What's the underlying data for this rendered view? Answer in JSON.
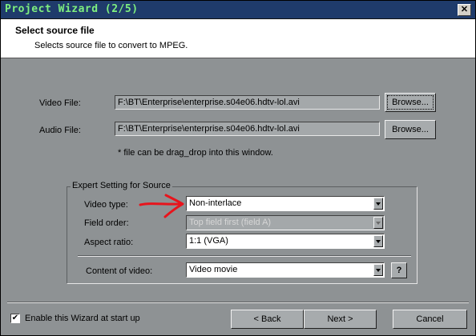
{
  "window": {
    "title": "Project Wizard (2/5)",
    "close_glyph": "✕"
  },
  "header": {
    "title": "Select source file",
    "subtitle": "Selects source file to convert to MPEG."
  },
  "source": {
    "video_label": "Video File:",
    "video_path": "F:\\BT\\Enterprise\\enterprise.s04e06.hdtv-lol.avi",
    "video_browse": "Browse...",
    "audio_label": "Audio File:",
    "audio_path": "F:\\BT\\Enterprise\\enterprise.s04e06.hdtv-lol.avi",
    "audio_browse": "Browse...",
    "note": "* file can be drag_drop into this window."
  },
  "expert": {
    "legend": "Expert Setting for Source",
    "video_type_label": "Video type:",
    "video_type_value": "Non-interlace",
    "field_order_label": "Field order:",
    "field_order_value": "Top field first (field A)",
    "aspect_label": "Aspect ratio:",
    "aspect_value": "1:1 (VGA)",
    "content_label": "Content of video:",
    "content_value": "Video movie",
    "help_label": "?"
  },
  "annotation": {
    "color": "#e8141c"
  },
  "footer": {
    "enable_label": "Enable this Wizard at start up",
    "enable_checked": true,
    "back_label": "< Back",
    "next_label": "Next >",
    "cancel_label": "Cancel"
  }
}
